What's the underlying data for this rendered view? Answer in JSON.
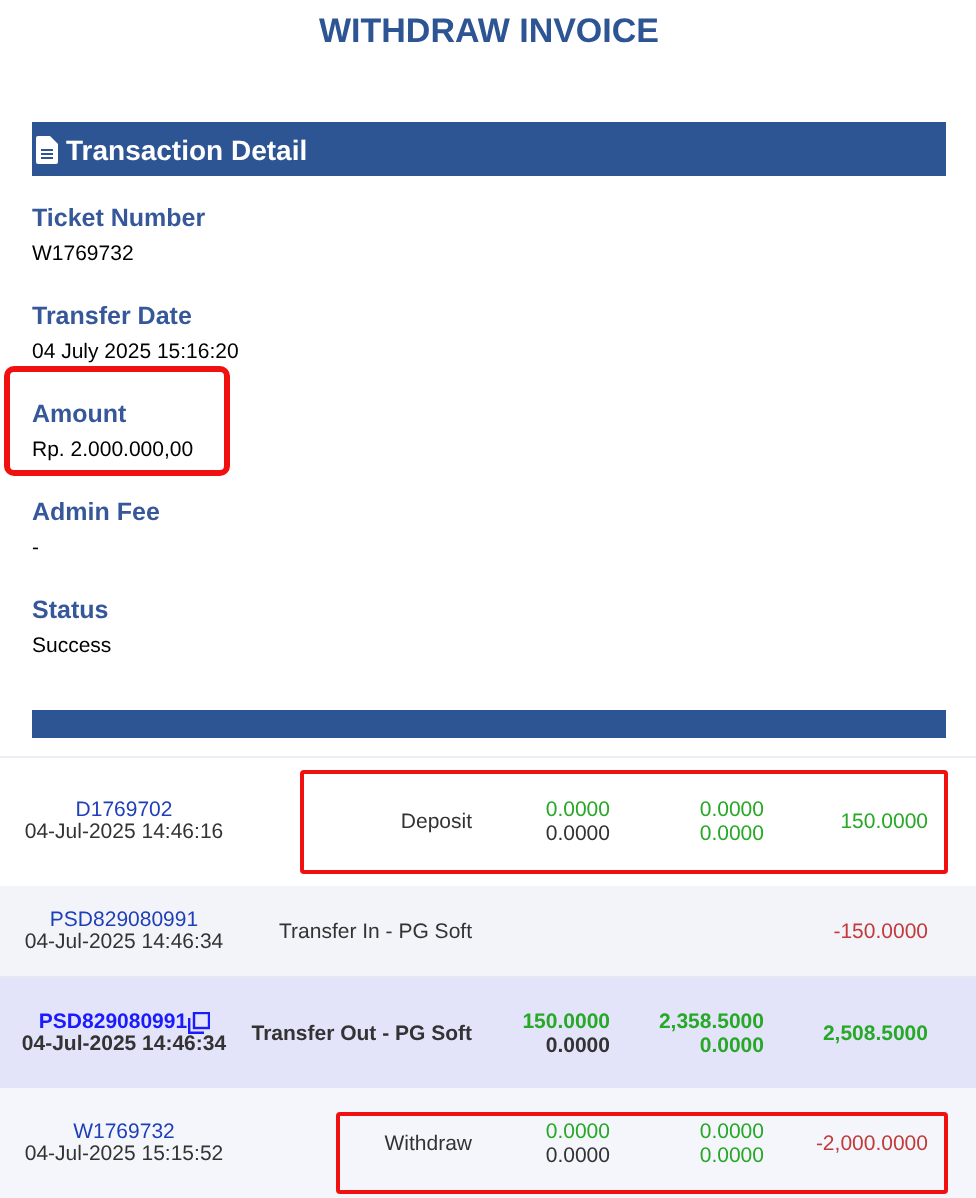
{
  "title": "WITHDRAW INVOICE",
  "transaction_section": {
    "title": "Transaction Detail"
  },
  "fields": [
    {
      "label": "Ticket Number",
      "value": "W1769732",
      "highlighted": false
    },
    {
      "label": "Transfer Date",
      "value": "04 July 2025 15:16:20",
      "highlighted": false
    },
    {
      "label": "Amount",
      "value": "Rp. 2.000.000,00",
      "highlighted": true
    },
    {
      "label": "Admin Fee",
      "value": "-",
      "highlighted": false
    },
    {
      "label": "Status",
      "value": "Success",
      "highlighted": false
    }
  ],
  "rows": [
    {
      "reference": "D1769702",
      "datetime": "04-Jul-2025 14:46:16",
      "type": "Deposit",
      "selected": false,
      "highlighted": true,
      "column_3": [
        {
          "text": "0.0000",
          "color": "#27a827"
        },
        {
          "text": "0.0000",
          "color": "#333333"
        }
      ],
      "column_4": [
        {
          "text": "0.0000",
          "color": "#27a827"
        },
        {
          "text": "0.0000",
          "color": "#27a827"
        }
      ],
      "column_5": [
        {
          "text": "150.0000",
          "color": "#27a827"
        }
      ]
    },
    {
      "reference": "PSD829080991",
      "datetime": "04-Jul-2025 14:46:34",
      "type": "Transfer In - PG Soft",
      "selected": false,
      "highlighted": false,
      "column_5": [
        {
          "text": "-150.0000",
          "color": "#c23b3b"
        }
      ]
    },
    {
      "reference": "PSD829080991",
      "datetime": "04-Jul-2025 14:46:34",
      "type": "Transfer Out - PG Soft",
      "selected": true,
      "highlighted": false,
      "column_3": [
        {
          "text": "150.0000",
          "color": "#27a827"
        },
        {
          "text": "0.0000",
          "color": "#333333"
        }
      ],
      "column_4": [
        {
          "text": "2,358.5000",
          "color": "#27a827"
        },
        {
          "text": "0.0000",
          "color": "#27a827"
        }
      ],
      "column_5": [
        {
          "text": "2,508.5000",
          "color": "#27a827"
        }
      ]
    },
    {
      "reference": "W1769732",
      "datetime": "04-Jul-2025 15:15:52",
      "type": "Withdraw",
      "selected": false,
      "highlighted": true,
      "column_3": [
        {
          "text": "0.0000",
          "color": "#27a827"
        },
        {
          "text": "0.0000",
          "color": "#333333"
        }
      ],
      "column_4": [
        {
          "text": "0.0000",
          "color": "#27a827"
        },
        {
          "text": "0.0000",
          "color": "#27a827"
        }
      ],
      "column_5": [
        {
          "text": "-2,000.0000",
          "color": "#c23b3b"
        }
      ]
    }
  ]
}
